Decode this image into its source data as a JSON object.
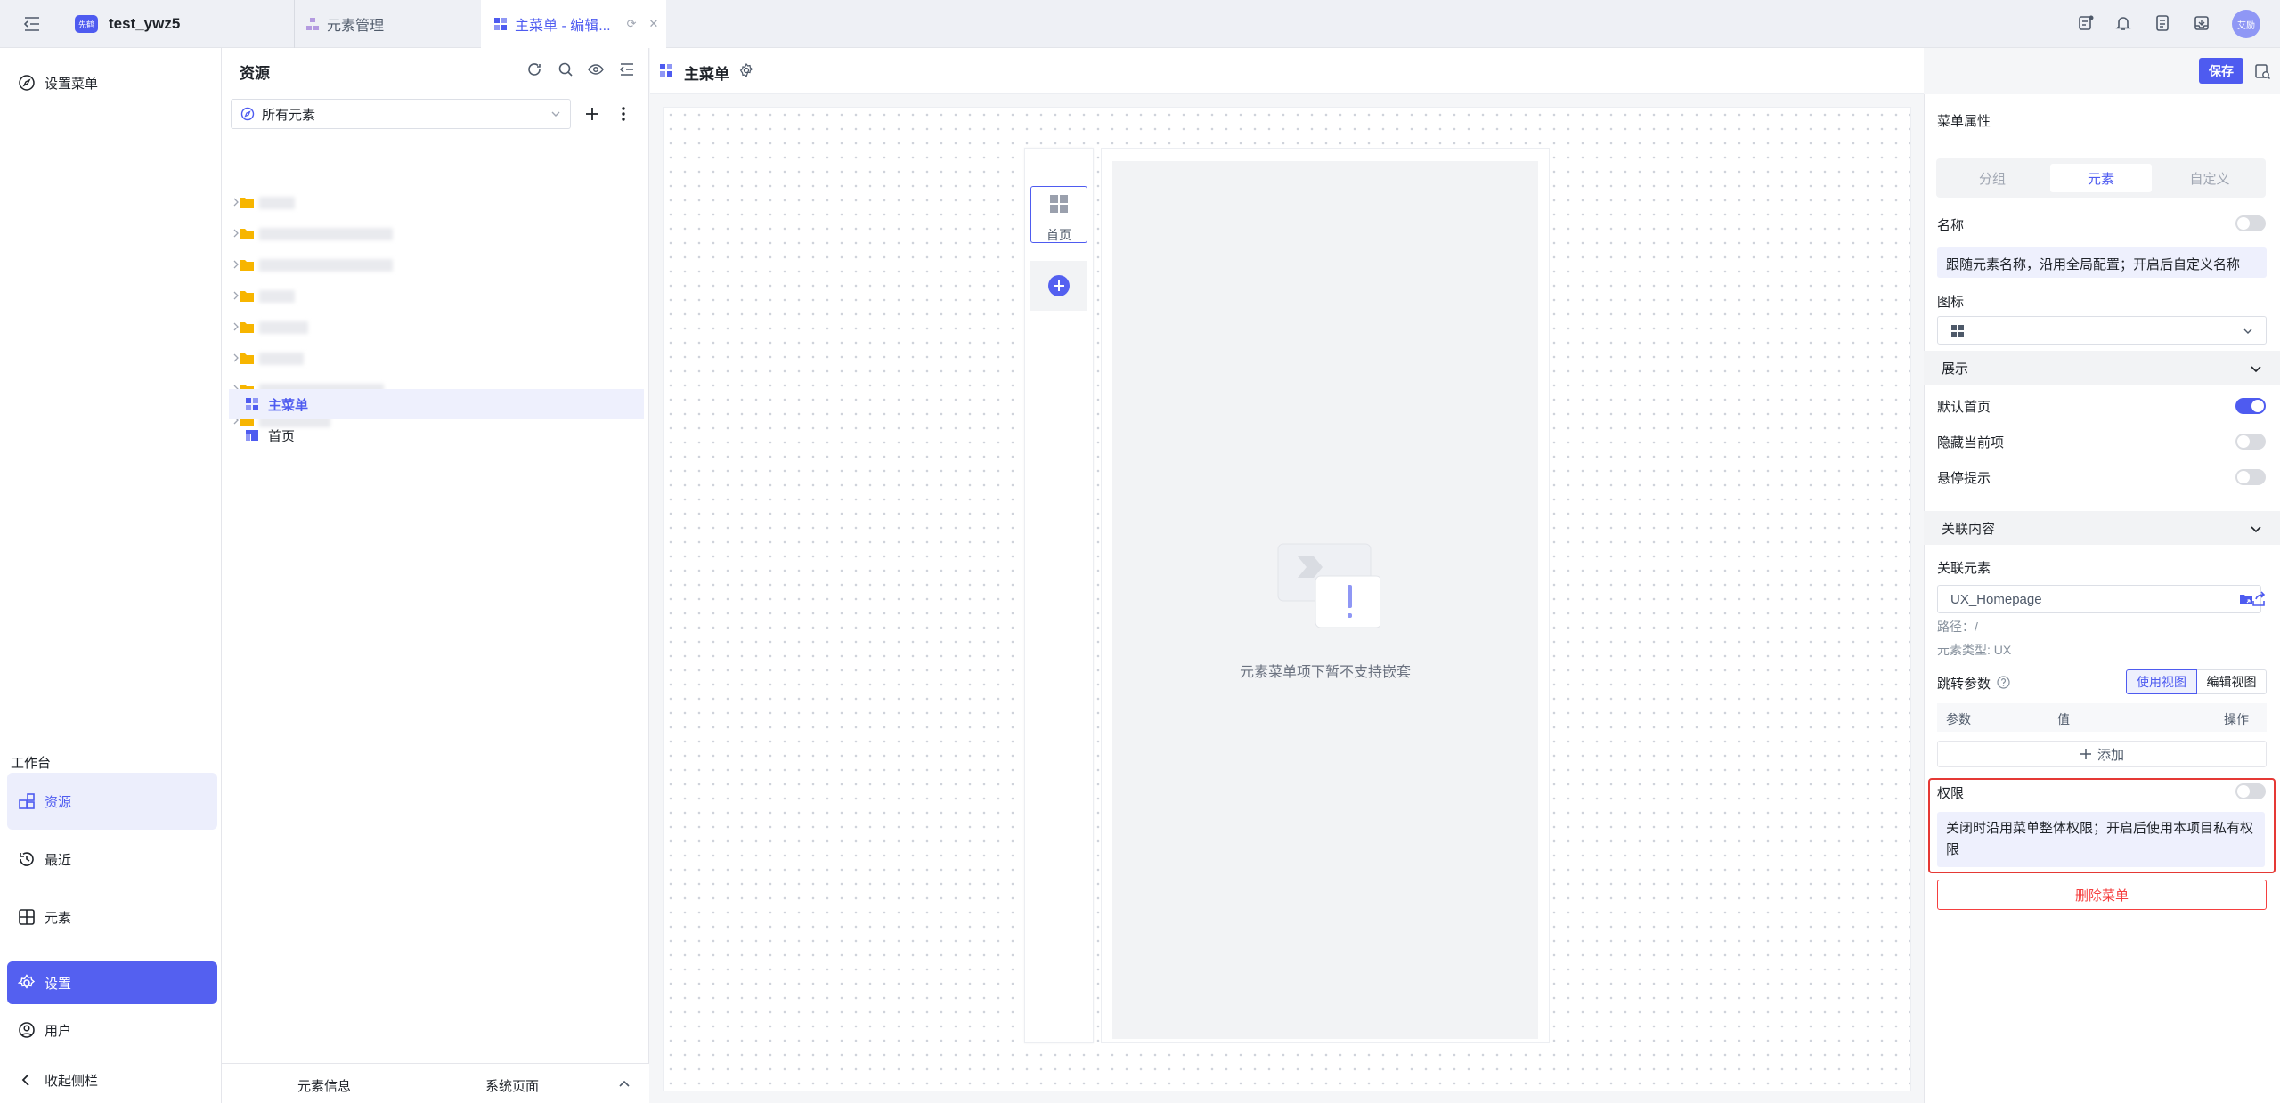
{
  "app": {
    "name": "test_ywz5",
    "badge": "先鹤"
  },
  "tabs": [
    {
      "label": "元素管理"
    },
    {
      "label": "主菜单 - 编辑..."
    }
  ],
  "user": {
    "avatar_text": "艾励"
  },
  "leftnav": {
    "top_item": "设置菜单",
    "section_title": "工作台",
    "items": [
      {
        "label": "资源"
      },
      {
        "label": "最近"
      },
      {
        "label": "元素"
      },
      {
        "label": "设置"
      },
      {
        "label": "用户"
      }
    ],
    "collapse": "收起侧栏"
  },
  "resources": {
    "title": "资源",
    "filter_value": "所有元素",
    "tree": [
      {
        "label": "主菜单"
      },
      {
        "label": "首页"
      }
    ],
    "footer": {
      "info": "元素信息",
      "system": "系统页面"
    }
  },
  "editor": {
    "title": "主菜单",
    "save": "保存",
    "menu_item_label": "首页",
    "empty_text": "元素菜单项下暂不支持嵌套"
  },
  "props": {
    "title": "菜单属性",
    "seg": [
      "分组",
      "元素",
      "自定义"
    ],
    "name_label": "名称",
    "name_value": "跟随元素名称，沿用全局配置；开启后自定义名称",
    "icon_label": "图标",
    "display_section": "展示",
    "default_home": "默认首页",
    "hide_current": "隐藏当前项",
    "hover_tip": "悬停提示",
    "related_section": "关联内容",
    "related_element_label": "关联元素",
    "related_element_value": "UX_Homepage",
    "path": "路径：/",
    "element_type": "元素类型: UX",
    "jump_params": "跳转参数",
    "use_view": "使用视图",
    "edit_view": "编辑视图",
    "param_cols": [
      "参数",
      "值",
      "操作"
    ],
    "add": "添加",
    "permission_label": "权限",
    "permission_desc": "关闭时沿用菜单整体权限；开启后使用本项目私有权限",
    "delete": "删除菜单"
  },
  "colors": {
    "accent": "#4e5bf0",
    "danger": "#f53f3f",
    "highlight_box": "#e53935"
  }
}
